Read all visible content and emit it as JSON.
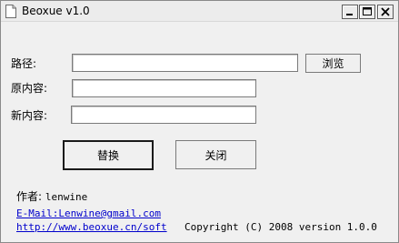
{
  "window": {
    "title": "Beoxue v1.0",
    "icon": "document-icon",
    "controls": [
      "minimize",
      "maximize",
      "close"
    ]
  },
  "form": {
    "path_label": "路径:",
    "path_value": "",
    "browse_label": "浏览",
    "original_label": "原内容:",
    "original_value": "",
    "new_label": "新内容:",
    "new_value": ""
  },
  "actions": {
    "replace_label": "替换",
    "close_label": "关闭"
  },
  "footer": {
    "author_prefix": "作者:",
    "author_name": "lenwine",
    "email": "E-Mail:Lenwine@gmail.com",
    "website": "http://www.beoxue.cn/soft",
    "copyright": "Copyright (C) 2008 version 1.0.0"
  }
}
